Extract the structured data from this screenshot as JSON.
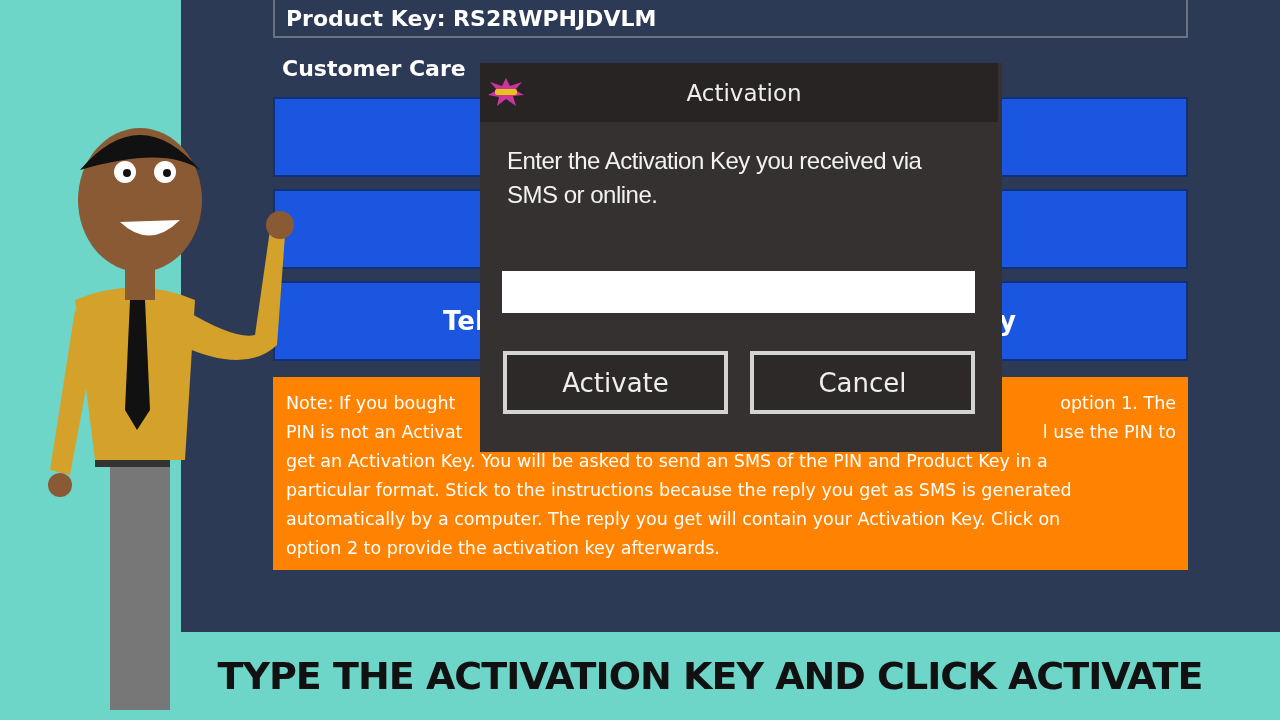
{
  "app": {
    "product_key": "Product Key: RS2RWPHJDVLM",
    "customer_care": "Customer Care",
    "option_buttons": [
      {
        "kind": "blank"
      },
      {
        "kind": "blank"
      },
      {
        "kind": "fragments",
        "label_fragments": [
          "Tel",
          "y"
        ]
      }
    ],
    "note_lines": [
      {
        "left": "Note: If you bought",
        "right": "option 1. The"
      },
      {
        "left": "PIN is not an Activat",
        "right": "l use the PIN to"
      },
      {
        "text": "get an Activation Key.  You will be asked to send an SMS of the PIN and Product Key in a"
      },
      {
        "text": "particular format. Stick to the instructions because the reply you get as SMS is generated"
      },
      {
        "text": "automatically by a computer. The reply you get will contain your Activation Key. Click on"
      },
      {
        "text": "option 2 to provide the activation key afterwards."
      }
    ]
  },
  "dialog": {
    "title": "Activation",
    "message": "Enter the Activation Key you received via SMS or online.",
    "buttons": [
      "Activate",
      "Cancel"
    ]
  },
  "caption": "TYPE THE ACTIVATION KEY AND CLICK ACTIVATE"
}
